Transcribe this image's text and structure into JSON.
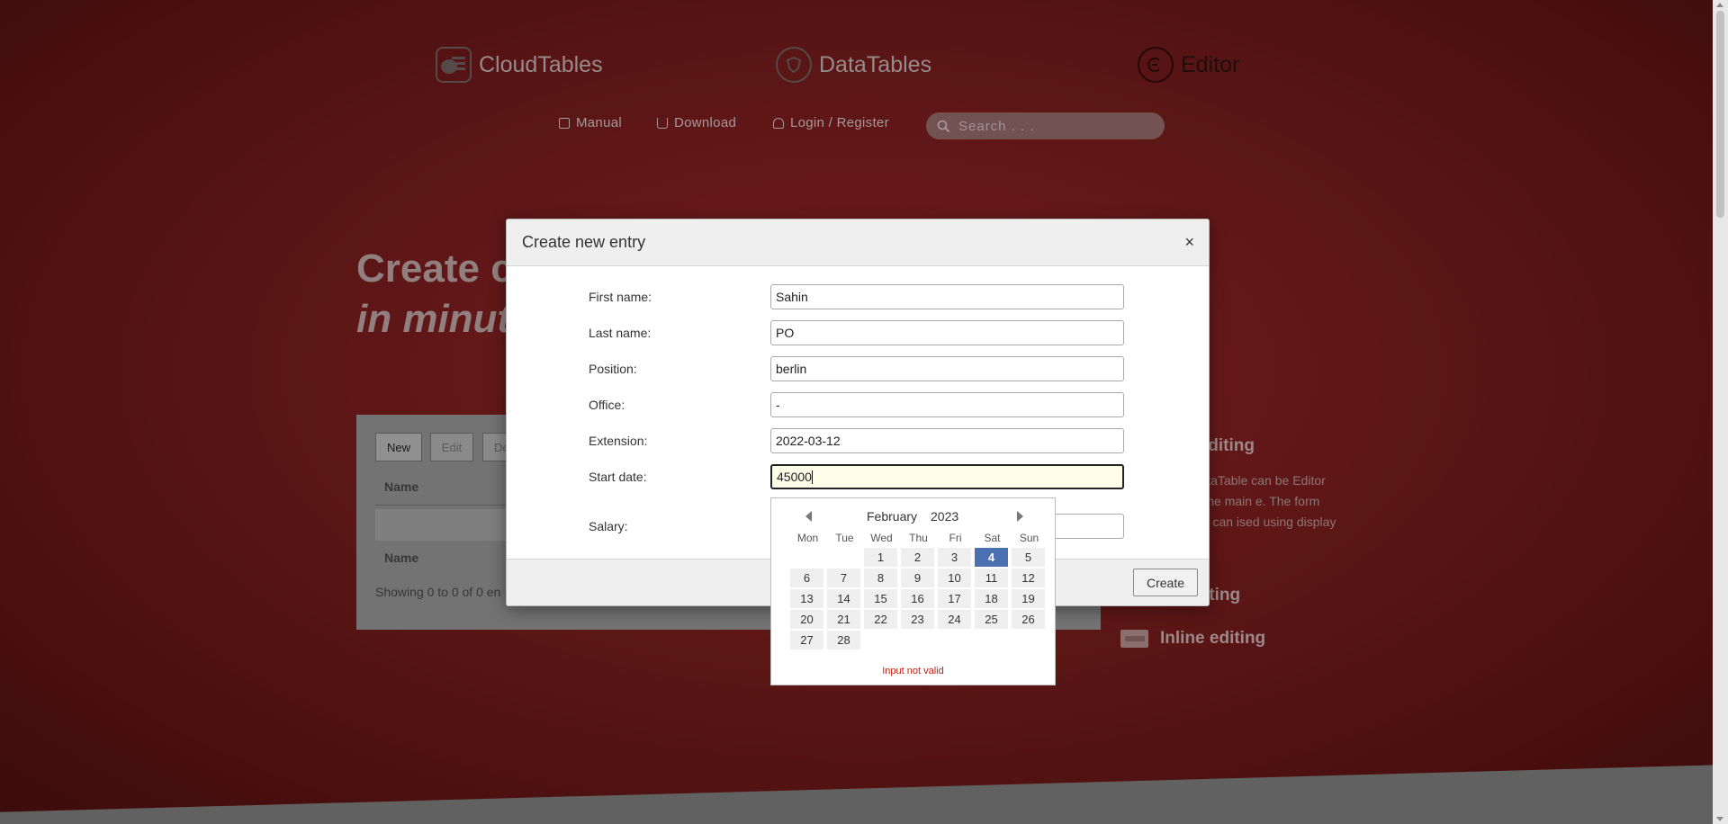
{
  "header": {
    "brands": [
      {
        "label": "CloudTables",
        "icon": "cloud-icon"
      },
      {
        "label": "DataTables",
        "icon": "datatables-logo-icon"
      },
      {
        "label": "Editor",
        "icon": "editor-logo-icon"
      }
    ],
    "nav": [
      {
        "label": "Manual",
        "icon": "book-icon"
      },
      {
        "label": "Download",
        "icon": "download-icon"
      },
      {
        "label": "Login / Register",
        "icon": "user-icon"
      }
    ],
    "search": {
      "placeholder": "Search . . ."
    }
  },
  "hero": {
    "line1": "Create c",
    "line2": "in minut"
  },
  "table_panel": {
    "buttons": {
      "new": "New",
      "edit": "Edit",
      "delete": "De"
    },
    "col_header": "Name",
    "col_footer": "Name",
    "info": "Showing 0 to 0 of 0 en"
  },
  "sidebar": {
    "row_editing": "ow editing",
    "row_editing_text": "n a DataTable can be Editor using the main e. The form display can ised using display",
    "bubble_editing": "e editing",
    "inline_editing": "Inline editing"
  },
  "modal": {
    "title": "Create new entry",
    "close": "×",
    "fields": [
      {
        "label": "First name:",
        "value": "Sahin"
      },
      {
        "label": "Last name:",
        "value": "PO"
      },
      {
        "label": "Position:",
        "value": "berlin"
      },
      {
        "label": "Office:",
        "value": "-"
      },
      {
        "label": "Extension:",
        "value": "2022-03-12"
      },
      {
        "label": "Start date:",
        "value": "45000"
      },
      {
        "label": "Salary:",
        "value": ""
      }
    ],
    "create_label": "Create"
  },
  "datepicker": {
    "month": "February",
    "year": "2023",
    "weekdays": [
      "Mon",
      "Tue",
      "Wed",
      "Thu",
      "Fri",
      "Sat",
      "Sun"
    ],
    "weeks": [
      [
        "",
        "",
        "1",
        "2",
        "3",
        "4",
        "5"
      ],
      [
        "6",
        "7",
        "8",
        "9",
        "10",
        "11",
        "12"
      ],
      [
        "13",
        "14",
        "15",
        "16",
        "17",
        "18",
        "19"
      ],
      [
        "20",
        "21",
        "22",
        "23",
        "24",
        "25",
        "26"
      ],
      [
        "27",
        "28",
        "",
        "",
        "",
        "",
        ""
      ]
    ],
    "selected_day": "4",
    "error": "Input not valid"
  },
  "colors": {
    "selected": "#4b70b1",
    "error": "#b21",
    "background": "#741c1c"
  }
}
